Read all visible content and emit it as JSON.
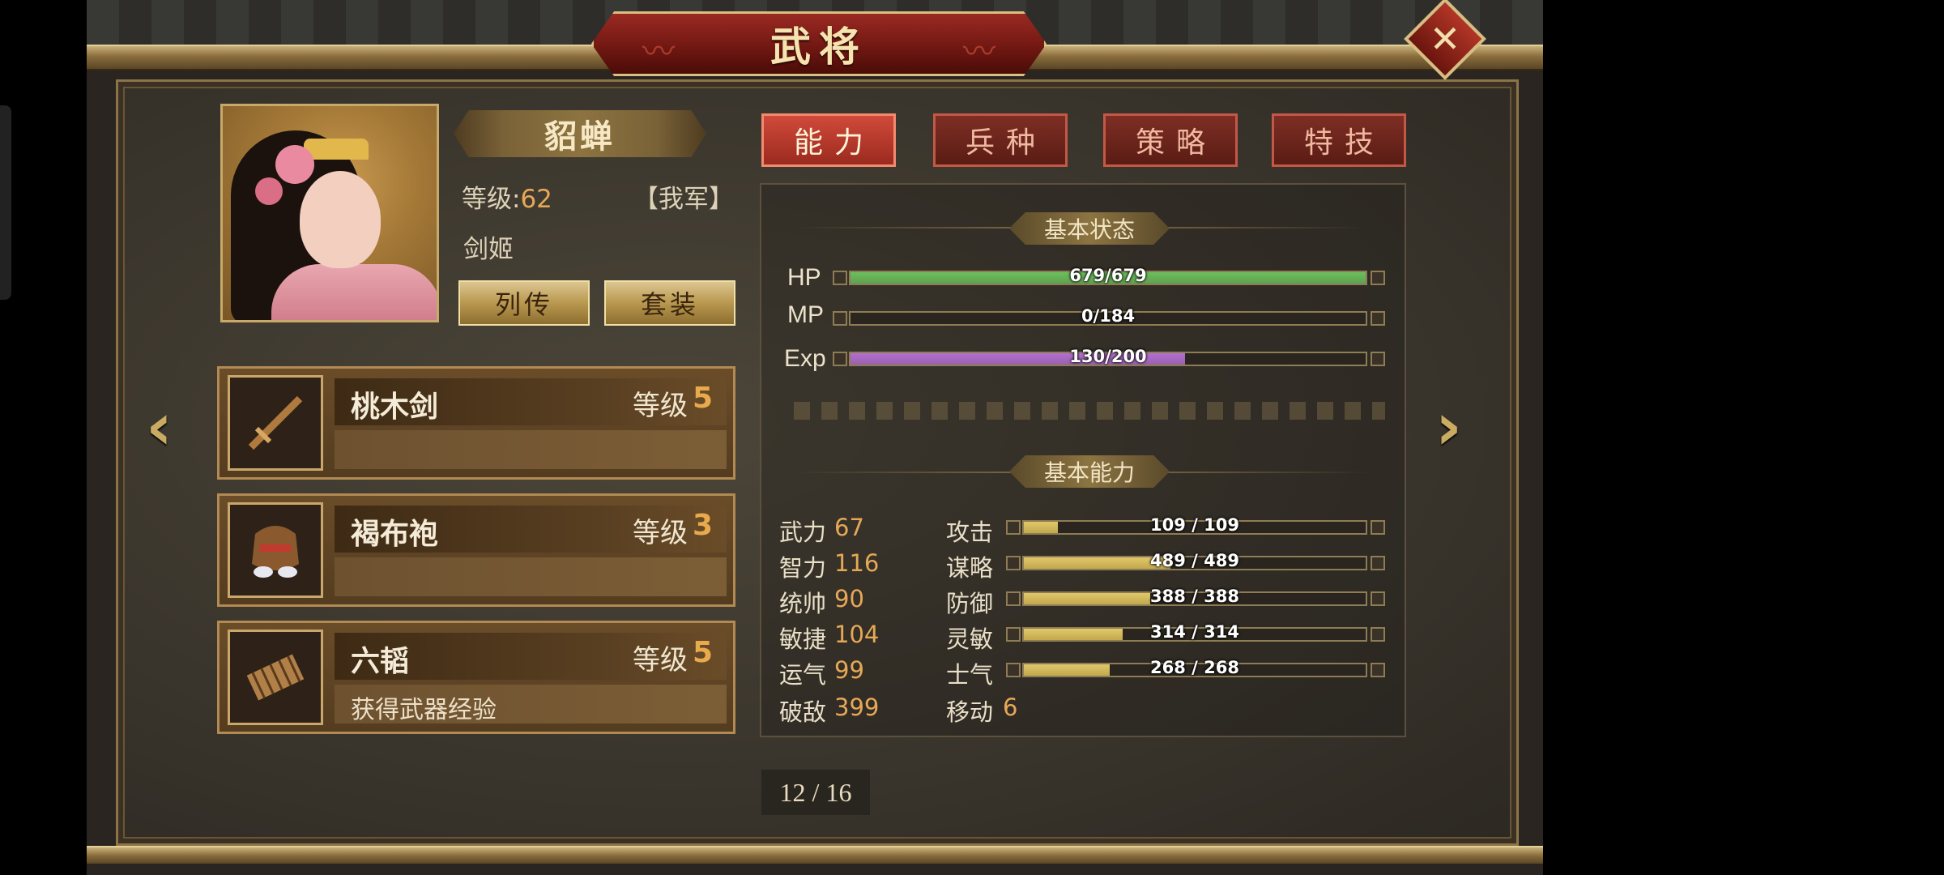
{
  "window": {
    "title": "武将"
  },
  "hero": {
    "name": "貂蝉",
    "level_label": "等级:",
    "level": "62",
    "faction": "【我军】",
    "class": "剑姬",
    "buttons": {
      "biography": "列传",
      "set": "套装"
    }
  },
  "equipment": [
    {
      "name": "桃木剑",
      "level_label": "等级",
      "level": "5",
      "desc": "",
      "icon": "sword-icon"
    },
    {
      "name": "褐布袍",
      "level_label": "等级",
      "level": "3",
      "desc": "",
      "icon": "armor-icon"
    },
    {
      "name": "六韬",
      "level_label": "等级",
      "level": "5",
      "desc": "获得武器经验",
      "icon": "scroll-icon"
    }
  ],
  "tabs": [
    {
      "label": "能力",
      "active": true
    },
    {
      "label": "兵种",
      "active": false
    },
    {
      "label": "策略",
      "active": false
    },
    {
      "label": "特技",
      "active": false
    }
  ],
  "status": {
    "header": "基本状态",
    "bars": [
      {
        "label": "HP",
        "text": "679/679",
        "fraction": 1.0,
        "color": "#6cbf5c"
      },
      {
        "label": "MP",
        "text": "0/184",
        "fraction": 0.0,
        "color": "#5b8fd8"
      },
      {
        "label": "Exp",
        "text": "130/200",
        "fraction": 0.65,
        "color": "#b46fd1"
      }
    ]
  },
  "abilities": {
    "header": "基本能力",
    "left": [
      {
        "name": "武力",
        "value": "67"
      },
      {
        "name": "智力",
        "value": "116"
      },
      {
        "name": "统帅",
        "value": "90"
      },
      {
        "name": "敏捷",
        "value": "104"
      },
      {
        "name": "运气",
        "value": "99"
      },
      {
        "name": "破敌",
        "value": "399"
      }
    ],
    "right": [
      {
        "name": "攻击",
        "text": "109 / 109",
        "fraction": 0.1
      },
      {
        "name": "谋略",
        "text": "489 / 489",
        "fraction": 0.43
      },
      {
        "name": "防御",
        "text": "388 / 388",
        "fraction": 0.37
      },
      {
        "name": "灵敏",
        "text": "314 / 314",
        "fraction": 0.29
      },
      {
        "name": "士气",
        "text": "268 / 268",
        "fraction": 0.25
      }
    ],
    "move": {
      "name": "移动",
      "value": "6"
    }
  },
  "pager": {
    "text": "12 / 16"
  },
  "colors": {
    "accent_red": "#9b2a1f",
    "gold": "#c9ab62",
    "stat_bar": "#c2a84e"
  }
}
